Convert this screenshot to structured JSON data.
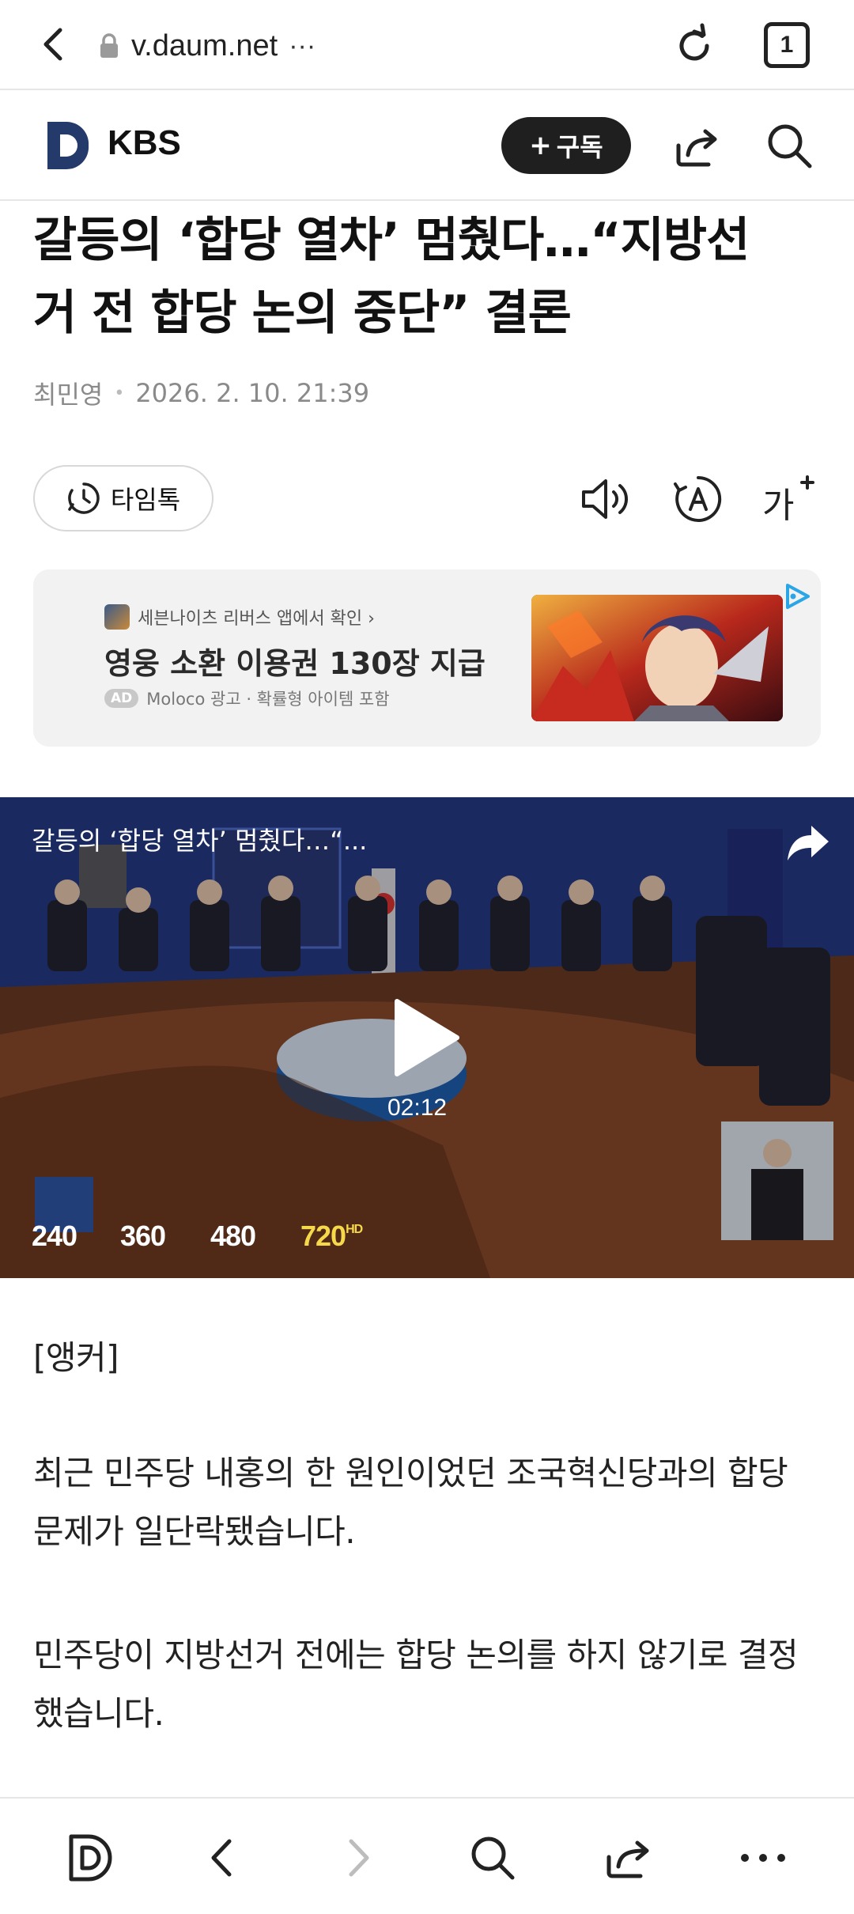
{
  "browser": {
    "url": "v.daum.net",
    "url_more": "···",
    "tab_count": "1"
  },
  "site": {
    "name": "KBS",
    "subscribe_label": "구독"
  },
  "article": {
    "headline_line1": "갈등의 ‘합당 열차’ 멈췄다…“지방선",
    "headline_line2": "거 전 합당 논의 중단” 결론",
    "author": "최민영",
    "datetime": "2026. 2. 10. 21:39",
    "timetalk_label": "타임톡",
    "paragraphs": [
      "[앵커]",
      "최근 민주당 내홍의 한 원인이었던 조국혁신당과의 합당 문제가 일단락됐습니다.",
      "민주당이 지방선거 전에는 합당 논의를 하지 않기로 결정했습니다."
    ]
  },
  "ad": {
    "source": "세븐나이츠 리버스 앱에서 확인 ›",
    "title": "영웅 소환 이용권 130장 지급",
    "badge": "AD",
    "meta": "Moloco 광고 · 확률형 아이템 포함"
  },
  "video": {
    "title": "갈등의 ‘합당 열차’ 멈췄다…“...",
    "duration": "02:12",
    "qualities": [
      "240",
      "360",
      "480",
      "720"
    ],
    "hd_label": "HD",
    "selected_quality": "720"
  },
  "colors": {
    "accent_quality": "#f6d94a",
    "subscribe_bg": "#1f1f1f",
    "ad_bg": "#f2f2f2"
  },
  "icons": [
    "back-icon",
    "lock-icon",
    "reload-icon",
    "tabs-icon",
    "daum-logo",
    "share-icon",
    "search-icon",
    "clock-icon",
    "audio-icon",
    "translate-icon",
    "font-size-icon",
    "adchoices-icon",
    "play-icon",
    "forward-icon",
    "more-icon"
  ]
}
